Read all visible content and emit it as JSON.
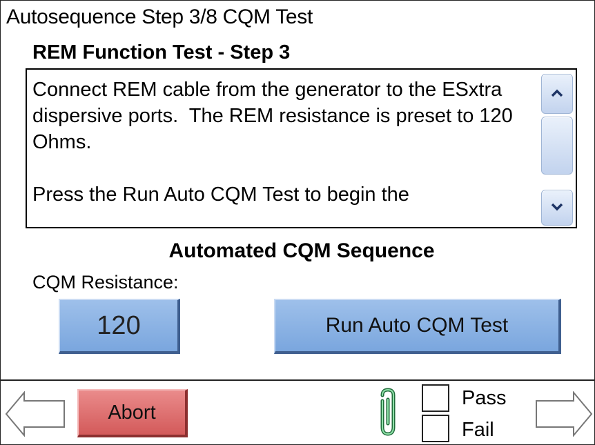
{
  "header": {
    "title": "Autosequence Step 3/8 CQM Test",
    "step_heading": "REM Function Test - Step 3"
  },
  "instructions": {
    "text": "Connect REM cable from the generator to the ESxtra dispersive ports.  The REM resistance is preset to 120 Ohms.\n\nPress the Run Auto CQM Test to begin the"
  },
  "sequence": {
    "heading": "Automated CQM Sequence",
    "resistance_label": "CQM Resistance:",
    "resistance_value": "120",
    "run_button_label": "Run Auto CQM Test"
  },
  "footer": {
    "abort_label": "Abort",
    "pass_label": "Pass",
    "fail_label": "Fail",
    "pass_checked": false,
    "fail_checked": false
  },
  "colors": {
    "blue_button": "#8cb4e6",
    "abort_button": "#e07070",
    "scrollbar": "#c8d8f0",
    "paperclip": "#2e8b57"
  },
  "icons": {
    "scroll_up": "chevron-up-icon",
    "scroll_down": "chevron-down-icon",
    "back": "arrow-left-icon",
    "forward": "arrow-right-icon",
    "attachment": "paperclip-icon"
  }
}
